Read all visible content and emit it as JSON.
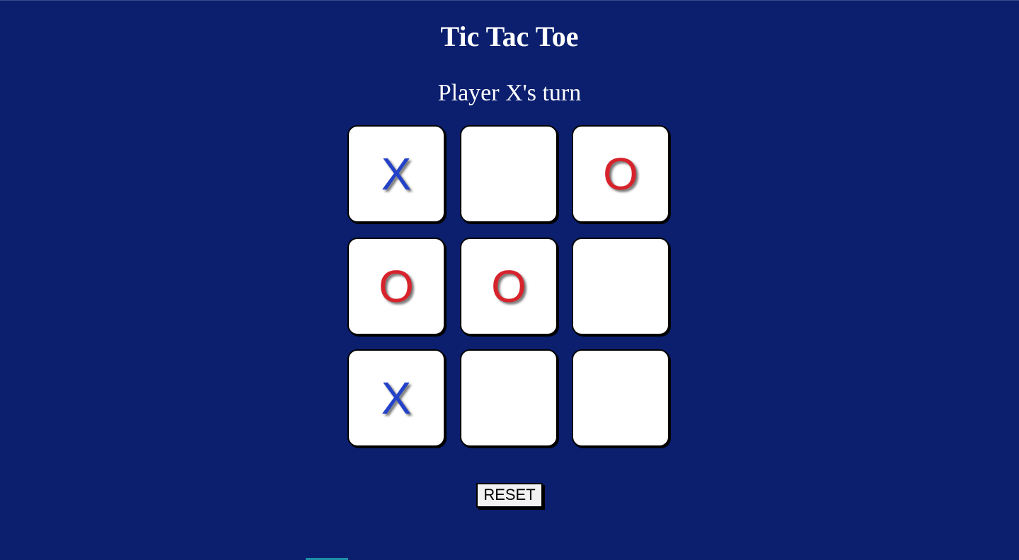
{
  "game": {
    "title": "Tic Tac Toe",
    "status": "Player X's turn",
    "board": [
      [
        "X",
        "",
        "O"
      ],
      [
        "O",
        "O",
        ""
      ],
      [
        "X",
        "",
        ""
      ]
    ],
    "reset_label": "RESET"
  },
  "colors": {
    "background": "#0b1f6e",
    "x_mark": "#2342c8",
    "o_mark": "#d6232c",
    "cell": "#ffffff"
  }
}
